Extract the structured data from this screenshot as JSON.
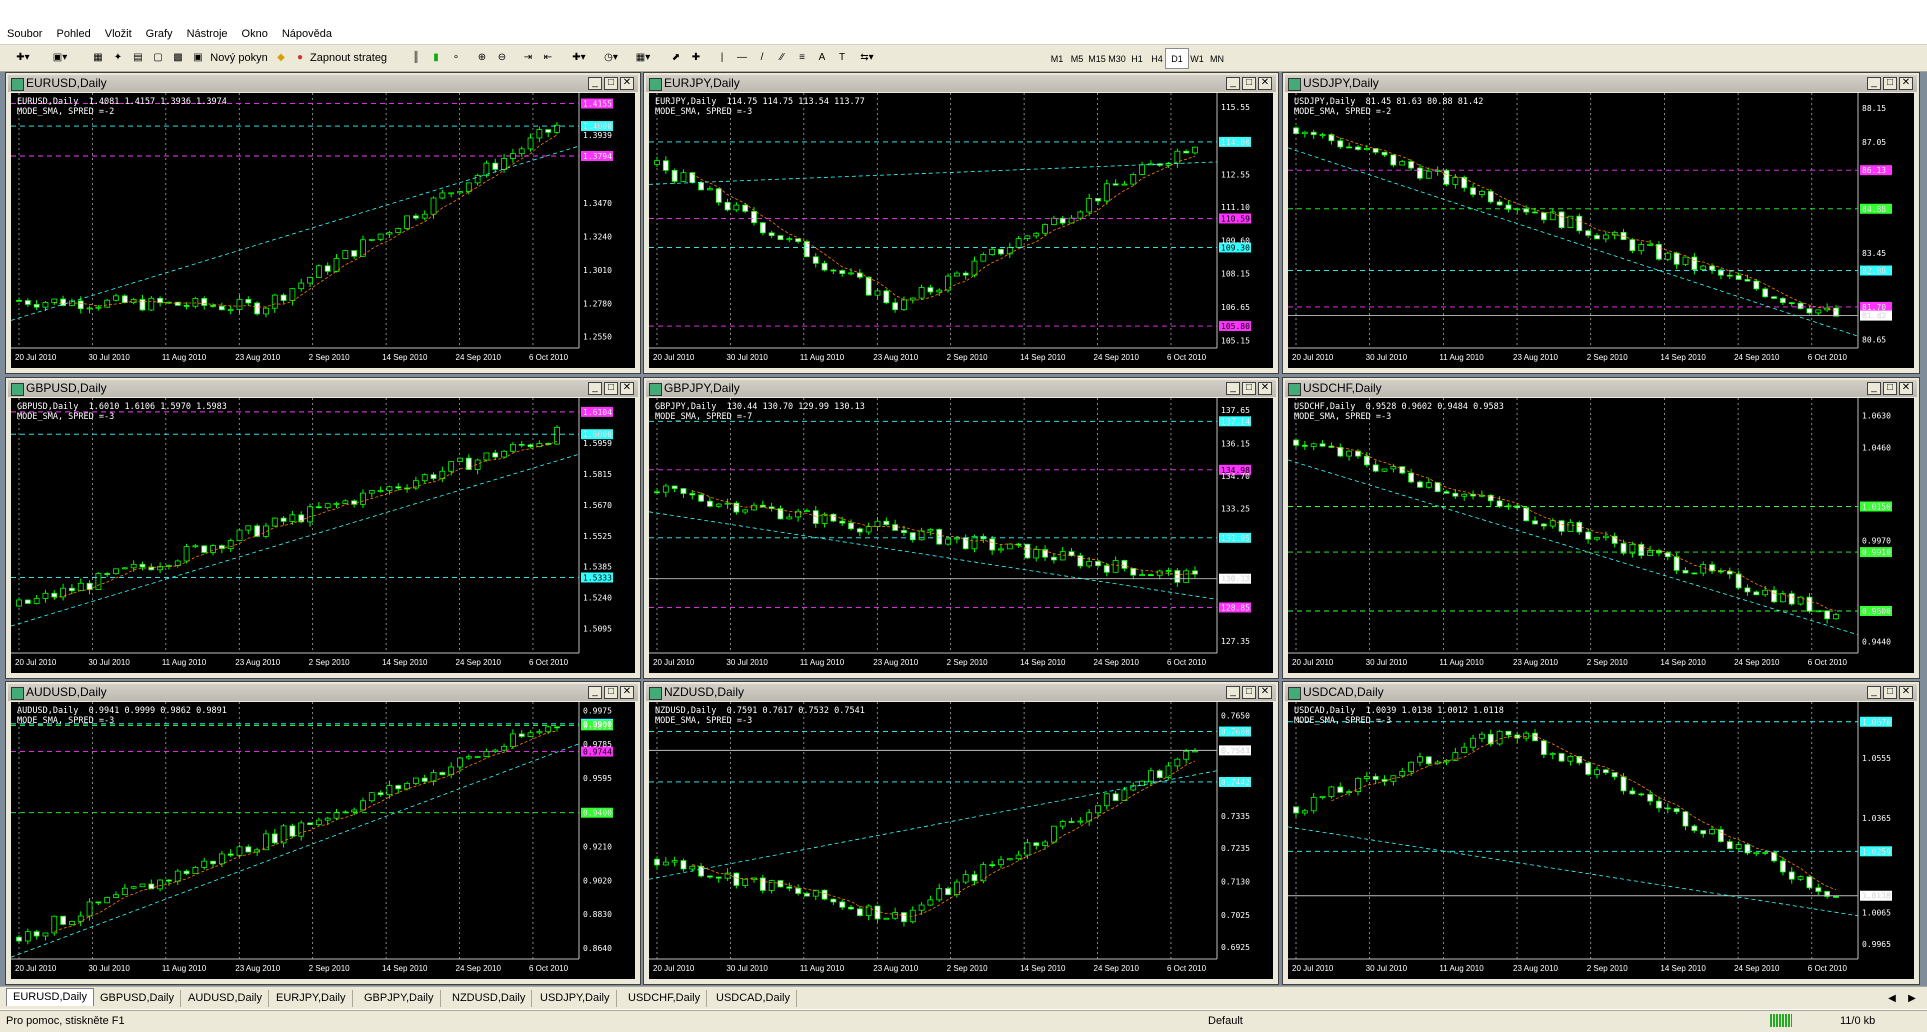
{
  "menu": [
    "Soubor",
    "Pohled",
    "Vložit",
    "Grafy",
    "Nástroje",
    "Okno",
    "Nápověda"
  ],
  "toolbar": {
    "new_order": "Nový pokyn",
    "auto_trading": "Zapnout strateg",
    "timeframes": [
      "M1",
      "M5",
      "M15",
      "M30",
      "H1",
      "H4",
      "D1",
      "W1",
      "MN"
    ],
    "active_timeframe": "D1"
  },
  "date_labels": [
    "20 Jul 2010",
    "30 Jul 2010",
    "11 Aug 2010",
    "23 Aug 2010",
    "2 Sep 2010",
    "14 Sep 2010",
    "24 Sep 2010",
    "6 Oct 2010"
  ],
  "charts": [
    {
      "title": "EURUSD,Daily",
      "info1": "EURUSD,Daily  1.4081 1.4157 1.3936 1.3974",
      "info2": "MODE_SMA, SPRED =-2",
      "scale": [
        "1.4155",
        "1.4000",
        "1.3939",
        "1.3794",
        "1.3470",
        "1.3240",
        "1.3010",
        "1.2780",
        "1.2550"
      ],
      "tags": [
        {
          "t": "1.4155",
          "bg": "#ff33ff"
        },
        {
          "t": "1.4000",
          "bg": "#33ffff"
        },
        {
          "t": "1.3794",
          "bg": "#ff33ff"
        }
      ],
      "start": 1.28,
      "end": 1.4,
      "lo": 1.25,
      "hi": 1.42,
      "shape": "v"
    },
    {
      "title": "EURJPY,Daily",
      "info1": "EURJPY,Daily  114.75 114.75 113.54 113.77",
      "info2": "MODE_SMA, SPRED =-3",
      "scale": [
        "115.55",
        "114.00",
        "112.55",
        "111.10",
        "109.60",
        "108.15",
        "106.65",
        "105.15"
      ],
      "tags": [
        {
          "t": "114.00",
          "bg": "#33ffff"
        },
        {
          "t": "110.59",
          "bg": "#ff33ff"
        },
        {
          "t": "109.30",
          "bg": "#33ffff"
        },
        {
          "t": "105.80",
          "bg": "#ff33ff"
        }
      ],
      "start": 113.0,
      "end": 114.0,
      "lo": 105.0,
      "hi": 116.0,
      "shape": "v"
    },
    {
      "title": "USDJPY,Daily",
      "info1": "USDJPY,Daily  81.45 81.63 80.88 81.42",
      "info2": "MODE_SMA, SPRED =-2",
      "scale": [
        "88.15",
        "87.05",
        "86.13",
        "84.88",
        "83.45",
        "82.88",
        "81.70",
        "81.42",
        "80.65"
      ],
      "tags": [
        {
          "t": "86.13",
          "bg": "#ff33ff"
        },
        {
          "t": "84.88",
          "bg": "#33ff33"
        },
        {
          "t": "82.88",
          "bg": "#33ffff"
        },
        {
          "t": "81.70",
          "bg": "#ff33ff"
        },
        {
          "t": "81.42",
          "bg": "#ffffff"
        }
      ],
      "start": 87.5,
      "end": 81.4,
      "lo": 80.5,
      "hi": 88.5,
      "shape": "down"
    },
    {
      "title": "GBPUSD,Daily",
      "info1": "GBPUSD,Daily  1.6010 1.6106 1.5970 1.5983",
      "info2": "MODE_SMA, SPRED =-3",
      "scale": [
        "1.6104",
        "1.6000",
        "1.5959",
        "1.5815",
        "1.5670",
        "1.5525",
        "1.5385",
        "1.5240",
        "1.5095"
      ],
      "tags": [
        {
          "t": "1.6104",
          "bg": "#ff33ff"
        },
        {
          "t": "1.6000",
          "bg": "#33ffff"
        },
        {
          "t": "1.5333",
          "bg": "#33ffff"
        }
      ],
      "start": 1.52,
      "end": 1.6,
      "lo": 1.5,
      "hi": 1.615,
      "shape": "up"
    },
    {
      "title": "GBPJPY,Daily",
      "info1": "GBPJPY,Daily  130.44 130.70 129.99 130.13",
      "info2": "MODE_SMA, SPRED =-7",
      "scale": [
        "137.65",
        "137.14",
        "136.15",
        "134.70",
        "133.25",
        "131.95",
        "130.13",
        "128.85",
        "127.35"
      ],
      "tags": [
        {
          "t": "137.14",
          "bg": "#33ffff"
        },
        {
          "t": "134.98",
          "bg": "#ff33ff"
        },
        {
          "t": "131.95",
          "bg": "#33ffff"
        },
        {
          "t": "130.13",
          "bg": "#ffffff"
        },
        {
          "t": "128.85",
          "bg": "#ff33ff"
        }
      ],
      "start": 134.0,
      "end": 130.1,
      "lo": 127.0,
      "hi": 138.0,
      "shape": "down"
    },
    {
      "title": "USDCHF,Daily",
      "info1": "USDCHF,Daily  0.9528 0.9602 0.9484 0.9583",
      "info2": "MODE_SMA, SPRED =-3",
      "scale": [
        "1.0630",
        "1.0460",
        "1.0150",
        "0.9970",
        "0.9910",
        "0.9600",
        "0.9440"
      ],
      "tags": [
        {
          "t": "1.0150",
          "bg": "#33ff33"
        },
        {
          "t": "0.9910",
          "bg": "#33ff33"
        },
        {
          "t": "0.9600",
          "bg": "#33ff33"
        }
      ],
      "start": 1.05,
      "end": 0.958,
      "lo": 0.94,
      "hi": 1.07,
      "shape": "down"
    },
    {
      "title": "AUDUSD,Daily",
      "info1": "AUDUSD,Daily  0.9941 0.9999 0.9862 0.9891",
      "info2": "MODE_SMA, SPRED =-3",
      "scale": [
        "0.9975",
        "0.9900",
        "0.9891",
        "0.9785",
        "0.9595",
        "0.9400",
        "0.9210",
        "0.9020",
        "0.8830",
        "0.8640"
      ],
      "tags": [
        {
          "t": "0.9900",
          "bg": "#33ffff"
        },
        {
          "t": "0.9891",
          "bg": "#33ff33"
        },
        {
          "t": "0.9744",
          "bg": "#ff33ff"
        },
        {
          "t": "0.9400",
          "bg": "#33ff33"
        }
      ],
      "start": 0.87,
      "end": 0.99,
      "lo": 0.86,
      "hi": 1.0,
      "shape": "up"
    },
    {
      "title": "NZDUSD,Daily",
      "info1": "NZDUSD,Daily  0.7591 0.7617 0.7532 0.7541",
      "info2": "MODE_SMA, SPRED =-3",
      "scale": [
        "0.7650",
        "0.7600",
        "0.7541",
        "0.7442",
        "0.7335",
        "0.7235",
        "0.7130",
        "0.7025",
        "0.6925"
      ],
      "tags": [
        {
          "t": "0.7600",
          "bg": "#33ffff"
        },
        {
          "t": "0.7541",
          "bg": "#ffffff"
        },
        {
          "t": "0.7442",
          "bg": "#33ffff"
        }
      ],
      "start": 0.72,
      "end": 0.754,
      "lo": 0.69,
      "hi": 0.768,
      "shape": "v"
    },
    {
      "title": "USDCAD,Daily",
      "info1": "USDCAD,Daily  1.0039 1.0138 1.0012 1.0118",
      "info2": "MODE_SMA, SPRED =-3",
      "scale": [
        "1.0670",
        "1.0555",
        "1.0365",
        "1.0259",
        "1.0118",
        "1.0065",
        "0.9965"
      ],
      "tags": [
        {
          "t": "1.0670",
          "bg": "#33ffff"
        },
        {
          "t": "1.0259",
          "bg": "#33ffff"
        },
        {
          "t": "1.0118",
          "bg": "#ffffff"
        }
      ],
      "start": 1.04,
      "end": 1.0118,
      "lo": 0.993,
      "hi": 1.072,
      "shape": "hump"
    }
  ],
  "tabs": [
    "EURUSD,Daily",
    "GBPUSD,Daily",
    "AUDUSD,Daily",
    "EURJPY,Daily",
    "GBPJPY,Daily",
    "NZDUSD,Daily",
    "USDJPY,Daily",
    "USDCHF,Daily",
    "USDCAD,Daily"
  ],
  "status": {
    "help": "Pro pomoc, stiskněte F1",
    "profile": "Default",
    "traffic": "11/0 kb"
  }
}
